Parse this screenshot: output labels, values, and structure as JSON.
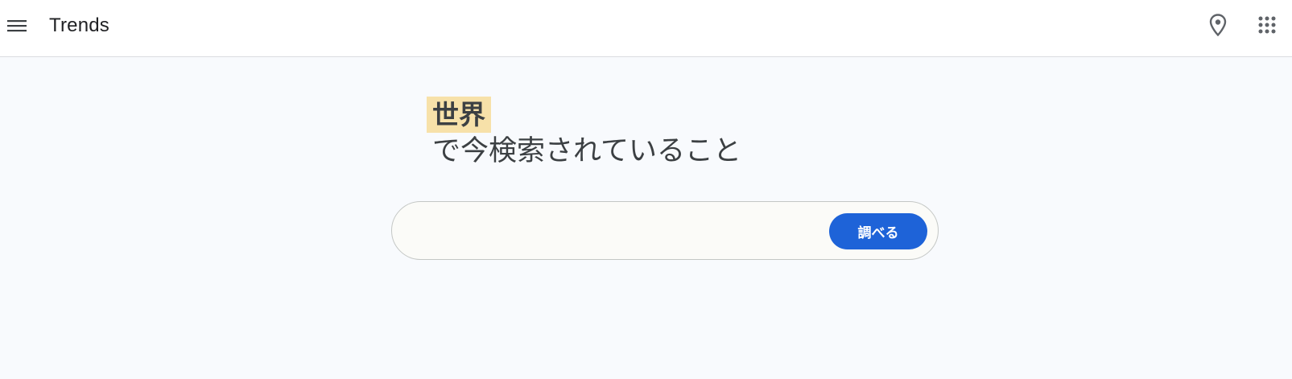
{
  "header": {
    "title": "Trends",
    "menu_icon": "menu-icon",
    "location_icon": "location-pin-icon",
    "apps_icon": "apps-grid-icon"
  },
  "hero": {
    "region": "世界",
    "headline": "で今検索されていること"
  },
  "search": {
    "value": "",
    "placeholder": "",
    "button_label": "調べる"
  },
  "colors": {
    "background": "#f8fafd",
    "region_highlight": "#f7e1a9",
    "button_blue": "#1e63d8",
    "text": "#3c4043"
  }
}
